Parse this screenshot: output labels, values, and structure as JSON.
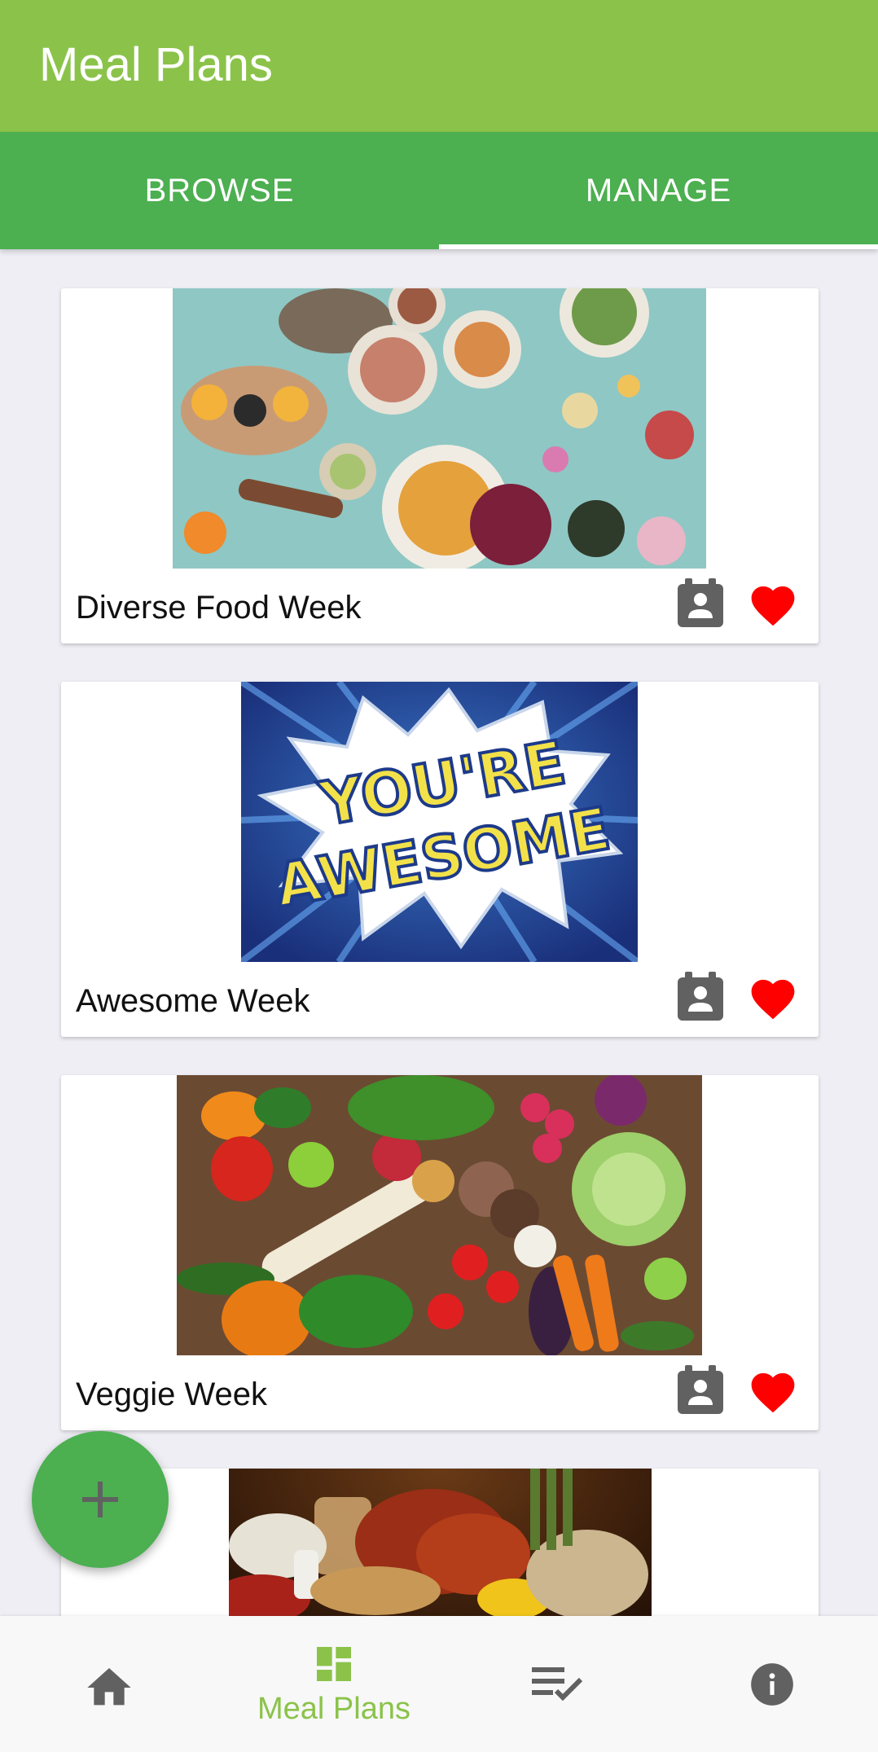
{
  "app": {
    "title": "Meal Plans"
  },
  "tabs": [
    {
      "label": "BROWSE",
      "selected": false
    },
    {
      "label": "MANAGE",
      "selected": true
    }
  ],
  "cards": [
    {
      "name": "Diverse Food Week",
      "image": "food-spread-photo",
      "favorite": true
    },
    {
      "name": "Awesome Week",
      "image": "youre-awesome-comic-graphic",
      "image_text": [
        "YOU'RE",
        "AWESOME"
      ],
      "favorite": true
    },
    {
      "name": "Veggie Week",
      "image": "vegetables-photo",
      "favorite": true
    },
    {
      "name": "",
      "image": "meat-and-bread-photo",
      "favorite": false
    }
  ],
  "fab": {
    "icon": "plus-icon"
  },
  "bottom_nav": {
    "items": [
      {
        "icon": "home-icon",
        "label": ""
      },
      {
        "icon": "dashboard-icon",
        "label": "Meal Plans",
        "active": true
      },
      {
        "icon": "checklist-icon",
        "label": ""
      },
      {
        "icon": "info-icon",
        "label": ""
      }
    ]
  },
  "colors": {
    "appbar": "#8bc34a",
    "tabbar": "#4caf50",
    "heart": "#ff0000",
    "active_nav": "#8bc34a",
    "icon_gray": "#616161"
  }
}
